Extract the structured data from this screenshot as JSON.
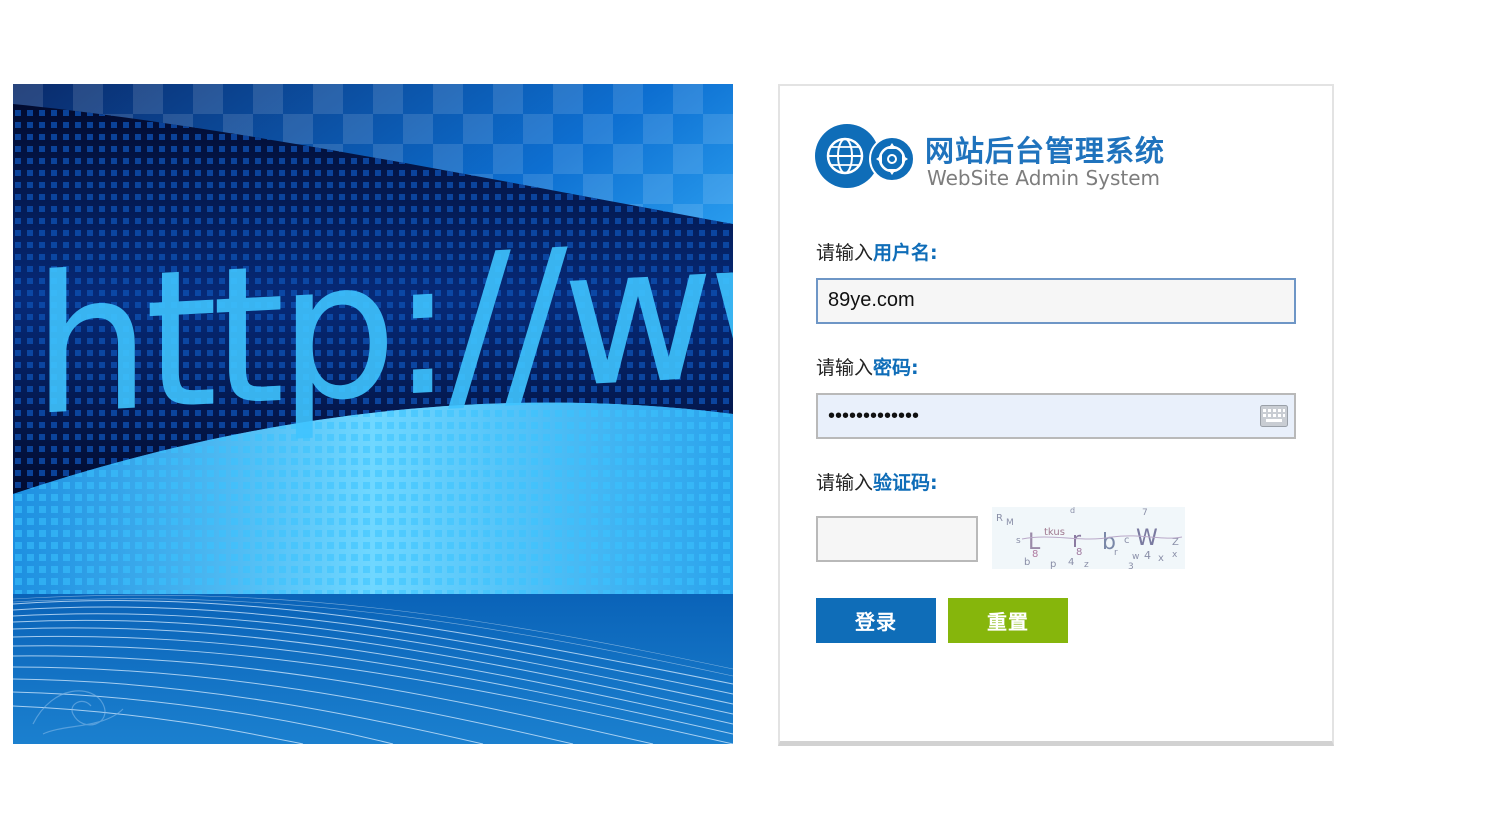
{
  "logo": {
    "title": "网站后台管理系统",
    "subtitle": "WebSite Admin System",
    "brand_color": "#1f73bd"
  },
  "hero": {
    "text": "http://www."
  },
  "form": {
    "username": {
      "prefix": "请输入",
      "label": "用户名:",
      "value": "89ye.com"
    },
    "password": {
      "prefix": "请输入",
      "label": "密码:",
      "masked_value": "•••••••••••••",
      "icon": "keyboard-icon"
    },
    "captcha": {
      "prefix": "请输入",
      "label": "验证码:",
      "value": ""
    }
  },
  "buttons": {
    "login": "登录",
    "reset": "重置",
    "login_color": "#0f6db8",
    "reset_color": "#86b60c"
  }
}
